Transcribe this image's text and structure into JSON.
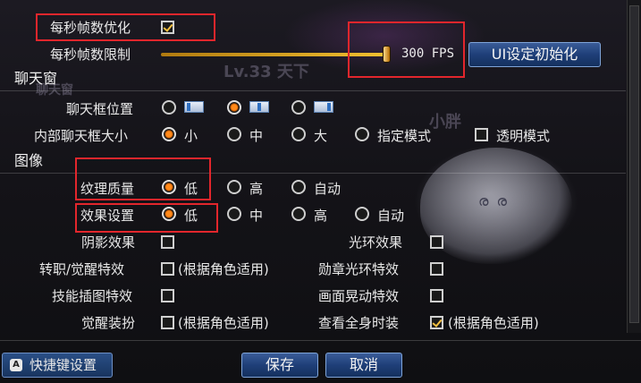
{
  "background": {
    "texts": [
      "Lv.33 天下",
      "聊天窗",
      "小胖"
    ]
  },
  "settings": {
    "fps_optimize_label": "每秒帧数优化",
    "fps_limit_label": "每秒帧数限制",
    "fps_value": "300 FPS",
    "fps_slider_fraction": 1.0,
    "reset_ui_button": "UI设定初始化"
  },
  "chat": {
    "section_title": "聊天窗",
    "position_label": "聊天框位置",
    "size_label": "内部聊天框大小",
    "size_options": [
      "小",
      "中",
      "大",
      "指定模式"
    ],
    "transparent_label": "透明模式"
  },
  "graphics": {
    "section_title": "图像",
    "texture_label": "纹理质量",
    "texture_options": [
      "低",
      "高",
      "自动"
    ],
    "effects_label": "效果设置",
    "effects_options": [
      "低",
      "中",
      "高",
      "自动"
    ],
    "shadow_label": "阴影效果",
    "halo_label": "光环效果",
    "job_effect_label": "转职/觉醒特效",
    "job_effect_note": "(根据角色适用)",
    "medal_label": "勋章光环特效",
    "skill_cutin_label": "技能插图特效",
    "screen_shake_label": "画面晃动特效",
    "awaken_gear_label": "觉醒装扮",
    "awaken_gear_note": "(根据角色适用)",
    "full_costume_label": "查看全身时装",
    "full_costume_note": "(根据角色适用)"
  },
  "footer": {
    "shortcut_key_glyph": "A",
    "shortcut_button": "快捷键设置",
    "save_button": "保存",
    "cancel_button": "取消"
  },
  "colors": {
    "highlight_box": "#e2262c",
    "radio_selected": "#ff8a1a",
    "button_blue": "#1f3f78"
  }
}
